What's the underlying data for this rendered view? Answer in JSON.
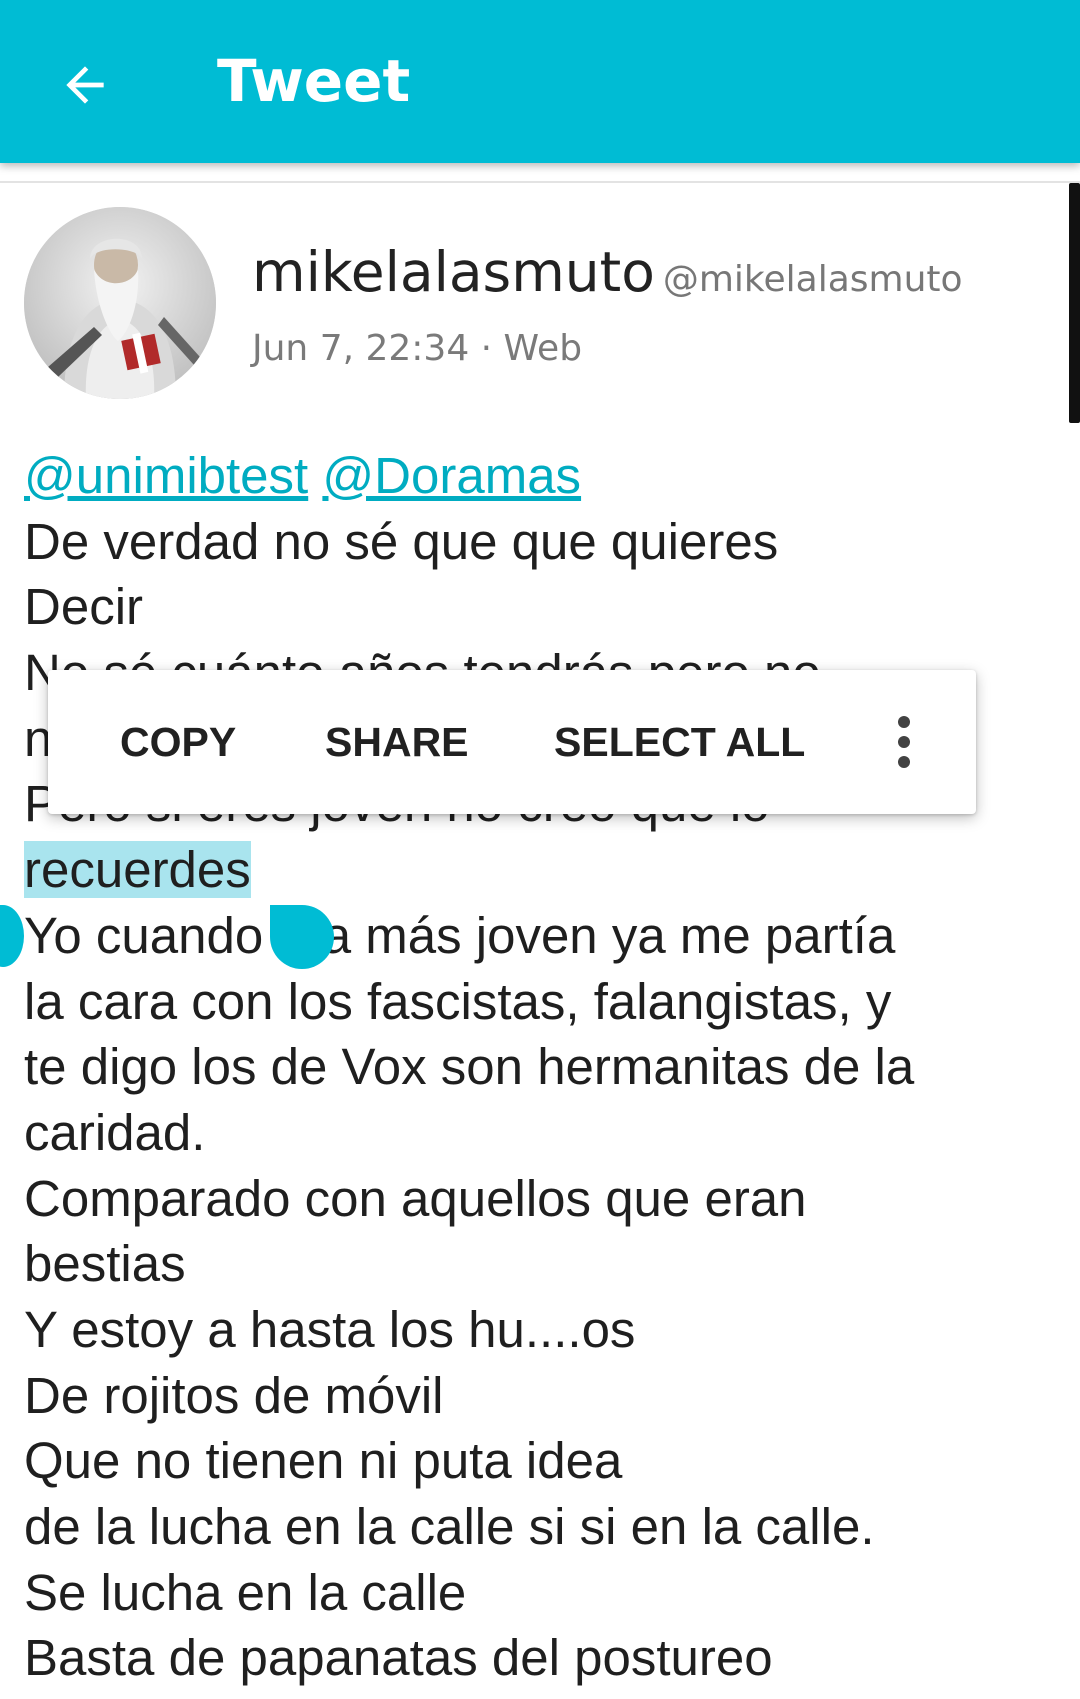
{
  "appbar": {
    "title": "Tweet",
    "back_icon": "arrow-back-icon",
    "color": "#00BCD4"
  },
  "tweet": {
    "user_name": "mikelalasmuto",
    "handle": "@mikelalasmuto",
    "meta": "Jun 7, 22:34 · Web",
    "mentions": [
      "@unimibtest",
      "@Doramas"
    ],
    "selected_text": "recuerdes",
    "lines": {
      "l3": "De verdad no sé que que quieres",
      "l4": "Decir",
      "l5": "No sé cuánto años tendrás pero no",
      "l6": "n",
      "l7": "Pero si eres joven no creo que lo",
      "l9": "Yo cuando era más joven ya me partía",
      "l10": "la cara con los fascistas, falangistas, y",
      "l11": "te digo los de Vox son hermanitas de la",
      "l12": "caridad.",
      "l13": "Comparado con aquellos que eran",
      "l14": "bestias",
      "l15": "Y estoy a hasta los hu....os",
      "l16": "De rojitos de móvil",
      "l17": "Que no tienen ni puta idea",
      "l18": "de la lucha en la calle si si en la calle.",
      "l19": "Se lucha en la calle",
      "l20": "Basta de papanatas del postureo"
    }
  },
  "selection_menu": {
    "copy": "COPY",
    "share": "SHARE",
    "select_all": "SELECT ALL",
    "more_icon": "more-vert-icon"
  },
  "colors": {
    "accent": "#00BCD4",
    "link": "#00ACC1",
    "selection": "#A9E4EE"
  }
}
